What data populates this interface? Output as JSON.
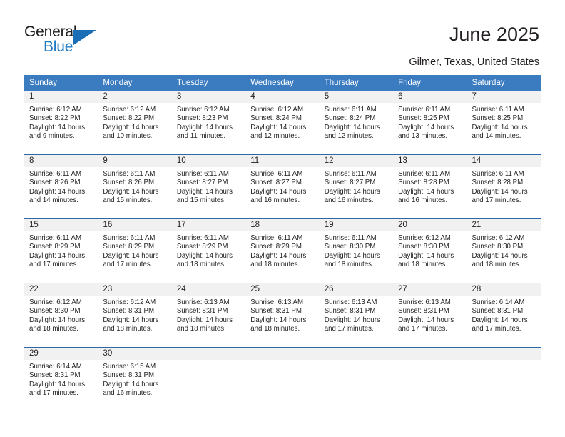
{
  "brand": {
    "name_top": "General",
    "name_bottom": "Blue",
    "triangle_color": "#1a6eb5",
    "blue_text_color": "#1f7ac4"
  },
  "header": {
    "title": "June 2025",
    "subtitle": "Gilmer, Texas, United States",
    "header_bg_color": "#3b7cc0",
    "row_divider_color": "#2a68a8",
    "datebar_bg_color": "#f1f1f1"
  },
  "weekdays": [
    "Sunday",
    "Monday",
    "Tuesday",
    "Wednesday",
    "Thursday",
    "Friday",
    "Saturday"
  ],
  "weeks": [
    [
      {
        "date": "1",
        "sunrise": "Sunrise: 6:12 AM",
        "sunset": "Sunset: 8:22 PM",
        "daylight_1": "Daylight: 14 hours",
        "daylight_2": "and 9 minutes."
      },
      {
        "date": "2",
        "sunrise": "Sunrise: 6:12 AM",
        "sunset": "Sunset: 8:22 PM",
        "daylight_1": "Daylight: 14 hours",
        "daylight_2": "and 10 minutes."
      },
      {
        "date": "3",
        "sunrise": "Sunrise: 6:12 AM",
        "sunset": "Sunset: 8:23 PM",
        "daylight_1": "Daylight: 14 hours",
        "daylight_2": "and 11 minutes."
      },
      {
        "date": "4",
        "sunrise": "Sunrise: 6:12 AM",
        "sunset": "Sunset: 8:24 PM",
        "daylight_1": "Daylight: 14 hours",
        "daylight_2": "and 12 minutes."
      },
      {
        "date": "5",
        "sunrise": "Sunrise: 6:11 AM",
        "sunset": "Sunset: 8:24 PM",
        "daylight_1": "Daylight: 14 hours",
        "daylight_2": "and 12 minutes."
      },
      {
        "date": "6",
        "sunrise": "Sunrise: 6:11 AM",
        "sunset": "Sunset: 8:25 PM",
        "daylight_1": "Daylight: 14 hours",
        "daylight_2": "and 13 minutes."
      },
      {
        "date": "7",
        "sunrise": "Sunrise: 6:11 AM",
        "sunset": "Sunset: 8:25 PM",
        "daylight_1": "Daylight: 14 hours",
        "daylight_2": "and 14 minutes."
      }
    ],
    [
      {
        "date": "8",
        "sunrise": "Sunrise: 6:11 AM",
        "sunset": "Sunset: 8:26 PM",
        "daylight_1": "Daylight: 14 hours",
        "daylight_2": "and 14 minutes."
      },
      {
        "date": "9",
        "sunrise": "Sunrise: 6:11 AM",
        "sunset": "Sunset: 8:26 PM",
        "daylight_1": "Daylight: 14 hours",
        "daylight_2": "and 15 minutes."
      },
      {
        "date": "10",
        "sunrise": "Sunrise: 6:11 AM",
        "sunset": "Sunset: 8:27 PM",
        "daylight_1": "Daylight: 14 hours",
        "daylight_2": "and 15 minutes."
      },
      {
        "date": "11",
        "sunrise": "Sunrise: 6:11 AM",
        "sunset": "Sunset: 8:27 PM",
        "daylight_1": "Daylight: 14 hours",
        "daylight_2": "and 16 minutes."
      },
      {
        "date": "12",
        "sunrise": "Sunrise: 6:11 AM",
        "sunset": "Sunset: 8:27 PM",
        "daylight_1": "Daylight: 14 hours",
        "daylight_2": "and 16 minutes."
      },
      {
        "date": "13",
        "sunrise": "Sunrise: 6:11 AM",
        "sunset": "Sunset: 8:28 PM",
        "daylight_1": "Daylight: 14 hours",
        "daylight_2": "and 16 minutes."
      },
      {
        "date": "14",
        "sunrise": "Sunrise: 6:11 AM",
        "sunset": "Sunset: 8:28 PM",
        "daylight_1": "Daylight: 14 hours",
        "daylight_2": "and 17 minutes."
      }
    ],
    [
      {
        "date": "15",
        "sunrise": "Sunrise: 6:11 AM",
        "sunset": "Sunset: 8:29 PM",
        "daylight_1": "Daylight: 14 hours",
        "daylight_2": "and 17 minutes."
      },
      {
        "date": "16",
        "sunrise": "Sunrise: 6:11 AM",
        "sunset": "Sunset: 8:29 PM",
        "daylight_1": "Daylight: 14 hours",
        "daylight_2": "and 17 minutes."
      },
      {
        "date": "17",
        "sunrise": "Sunrise: 6:11 AM",
        "sunset": "Sunset: 8:29 PM",
        "daylight_1": "Daylight: 14 hours",
        "daylight_2": "and 18 minutes."
      },
      {
        "date": "18",
        "sunrise": "Sunrise: 6:11 AM",
        "sunset": "Sunset: 8:29 PM",
        "daylight_1": "Daylight: 14 hours",
        "daylight_2": "and 18 minutes."
      },
      {
        "date": "19",
        "sunrise": "Sunrise: 6:11 AM",
        "sunset": "Sunset: 8:30 PM",
        "daylight_1": "Daylight: 14 hours",
        "daylight_2": "and 18 minutes."
      },
      {
        "date": "20",
        "sunrise": "Sunrise: 6:12 AM",
        "sunset": "Sunset: 8:30 PM",
        "daylight_1": "Daylight: 14 hours",
        "daylight_2": "and 18 minutes."
      },
      {
        "date": "21",
        "sunrise": "Sunrise: 6:12 AM",
        "sunset": "Sunset: 8:30 PM",
        "daylight_1": "Daylight: 14 hours",
        "daylight_2": "and 18 minutes."
      }
    ],
    [
      {
        "date": "22",
        "sunrise": "Sunrise: 6:12 AM",
        "sunset": "Sunset: 8:30 PM",
        "daylight_1": "Daylight: 14 hours",
        "daylight_2": "and 18 minutes."
      },
      {
        "date": "23",
        "sunrise": "Sunrise: 6:12 AM",
        "sunset": "Sunset: 8:31 PM",
        "daylight_1": "Daylight: 14 hours",
        "daylight_2": "and 18 minutes."
      },
      {
        "date": "24",
        "sunrise": "Sunrise: 6:13 AM",
        "sunset": "Sunset: 8:31 PM",
        "daylight_1": "Daylight: 14 hours",
        "daylight_2": "and 18 minutes."
      },
      {
        "date": "25",
        "sunrise": "Sunrise: 6:13 AM",
        "sunset": "Sunset: 8:31 PM",
        "daylight_1": "Daylight: 14 hours",
        "daylight_2": "and 18 minutes."
      },
      {
        "date": "26",
        "sunrise": "Sunrise: 6:13 AM",
        "sunset": "Sunset: 8:31 PM",
        "daylight_1": "Daylight: 14 hours",
        "daylight_2": "and 17 minutes."
      },
      {
        "date": "27",
        "sunrise": "Sunrise: 6:13 AM",
        "sunset": "Sunset: 8:31 PM",
        "daylight_1": "Daylight: 14 hours",
        "daylight_2": "and 17 minutes."
      },
      {
        "date": "28",
        "sunrise": "Sunrise: 6:14 AM",
        "sunset": "Sunset: 8:31 PM",
        "daylight_1": "Daylight: 14 hours",
        "daylight_2": "and 17 minutes."
      }
    ],
    [
      {
        "date": "29",
        "sunrise": "Sunrise: 6:14 AM",
        "sunset": "Sunset: 8:31 PM",
        "daylight_1": "Daylight: 14 hours",
        "daylight_2": "and 17 minutes."
      },
      {
        "date": "30",
        "sunrise": "Sunrise: 6:15 AM",
        "sunset": "Sunset: 8:31 PM",
        "daylight_1": "Daylight: 14 hours",
        "daylight_2": "and 16 minutes."
      },
      {
        "date": "",
        "sunrise": "",
        "sunset": "",
        "daylight_1": "",
        "daylight_2": ""
      },
      {
        "date": "",
        "sunrise": "",
        "sunset": "",
        "daylight_1": "",
        "daylight_2": ""
      },
      {
        "date": "",
        "sunrise": "",
        "sunset": "",
        "daylight_1": "",
        "daylight_2": ""
      },
      {
        "date": "",
        "sunrise": "",
        "sunset": "",
        "daylight_1": "",
        "daylight_2": ""
      },
      {
        "date": "",
        "sunrise": "",
        "sunset": "",
        "daylight_1": "",
        "daylight_2": ""
      }
    ]
  ]
}
